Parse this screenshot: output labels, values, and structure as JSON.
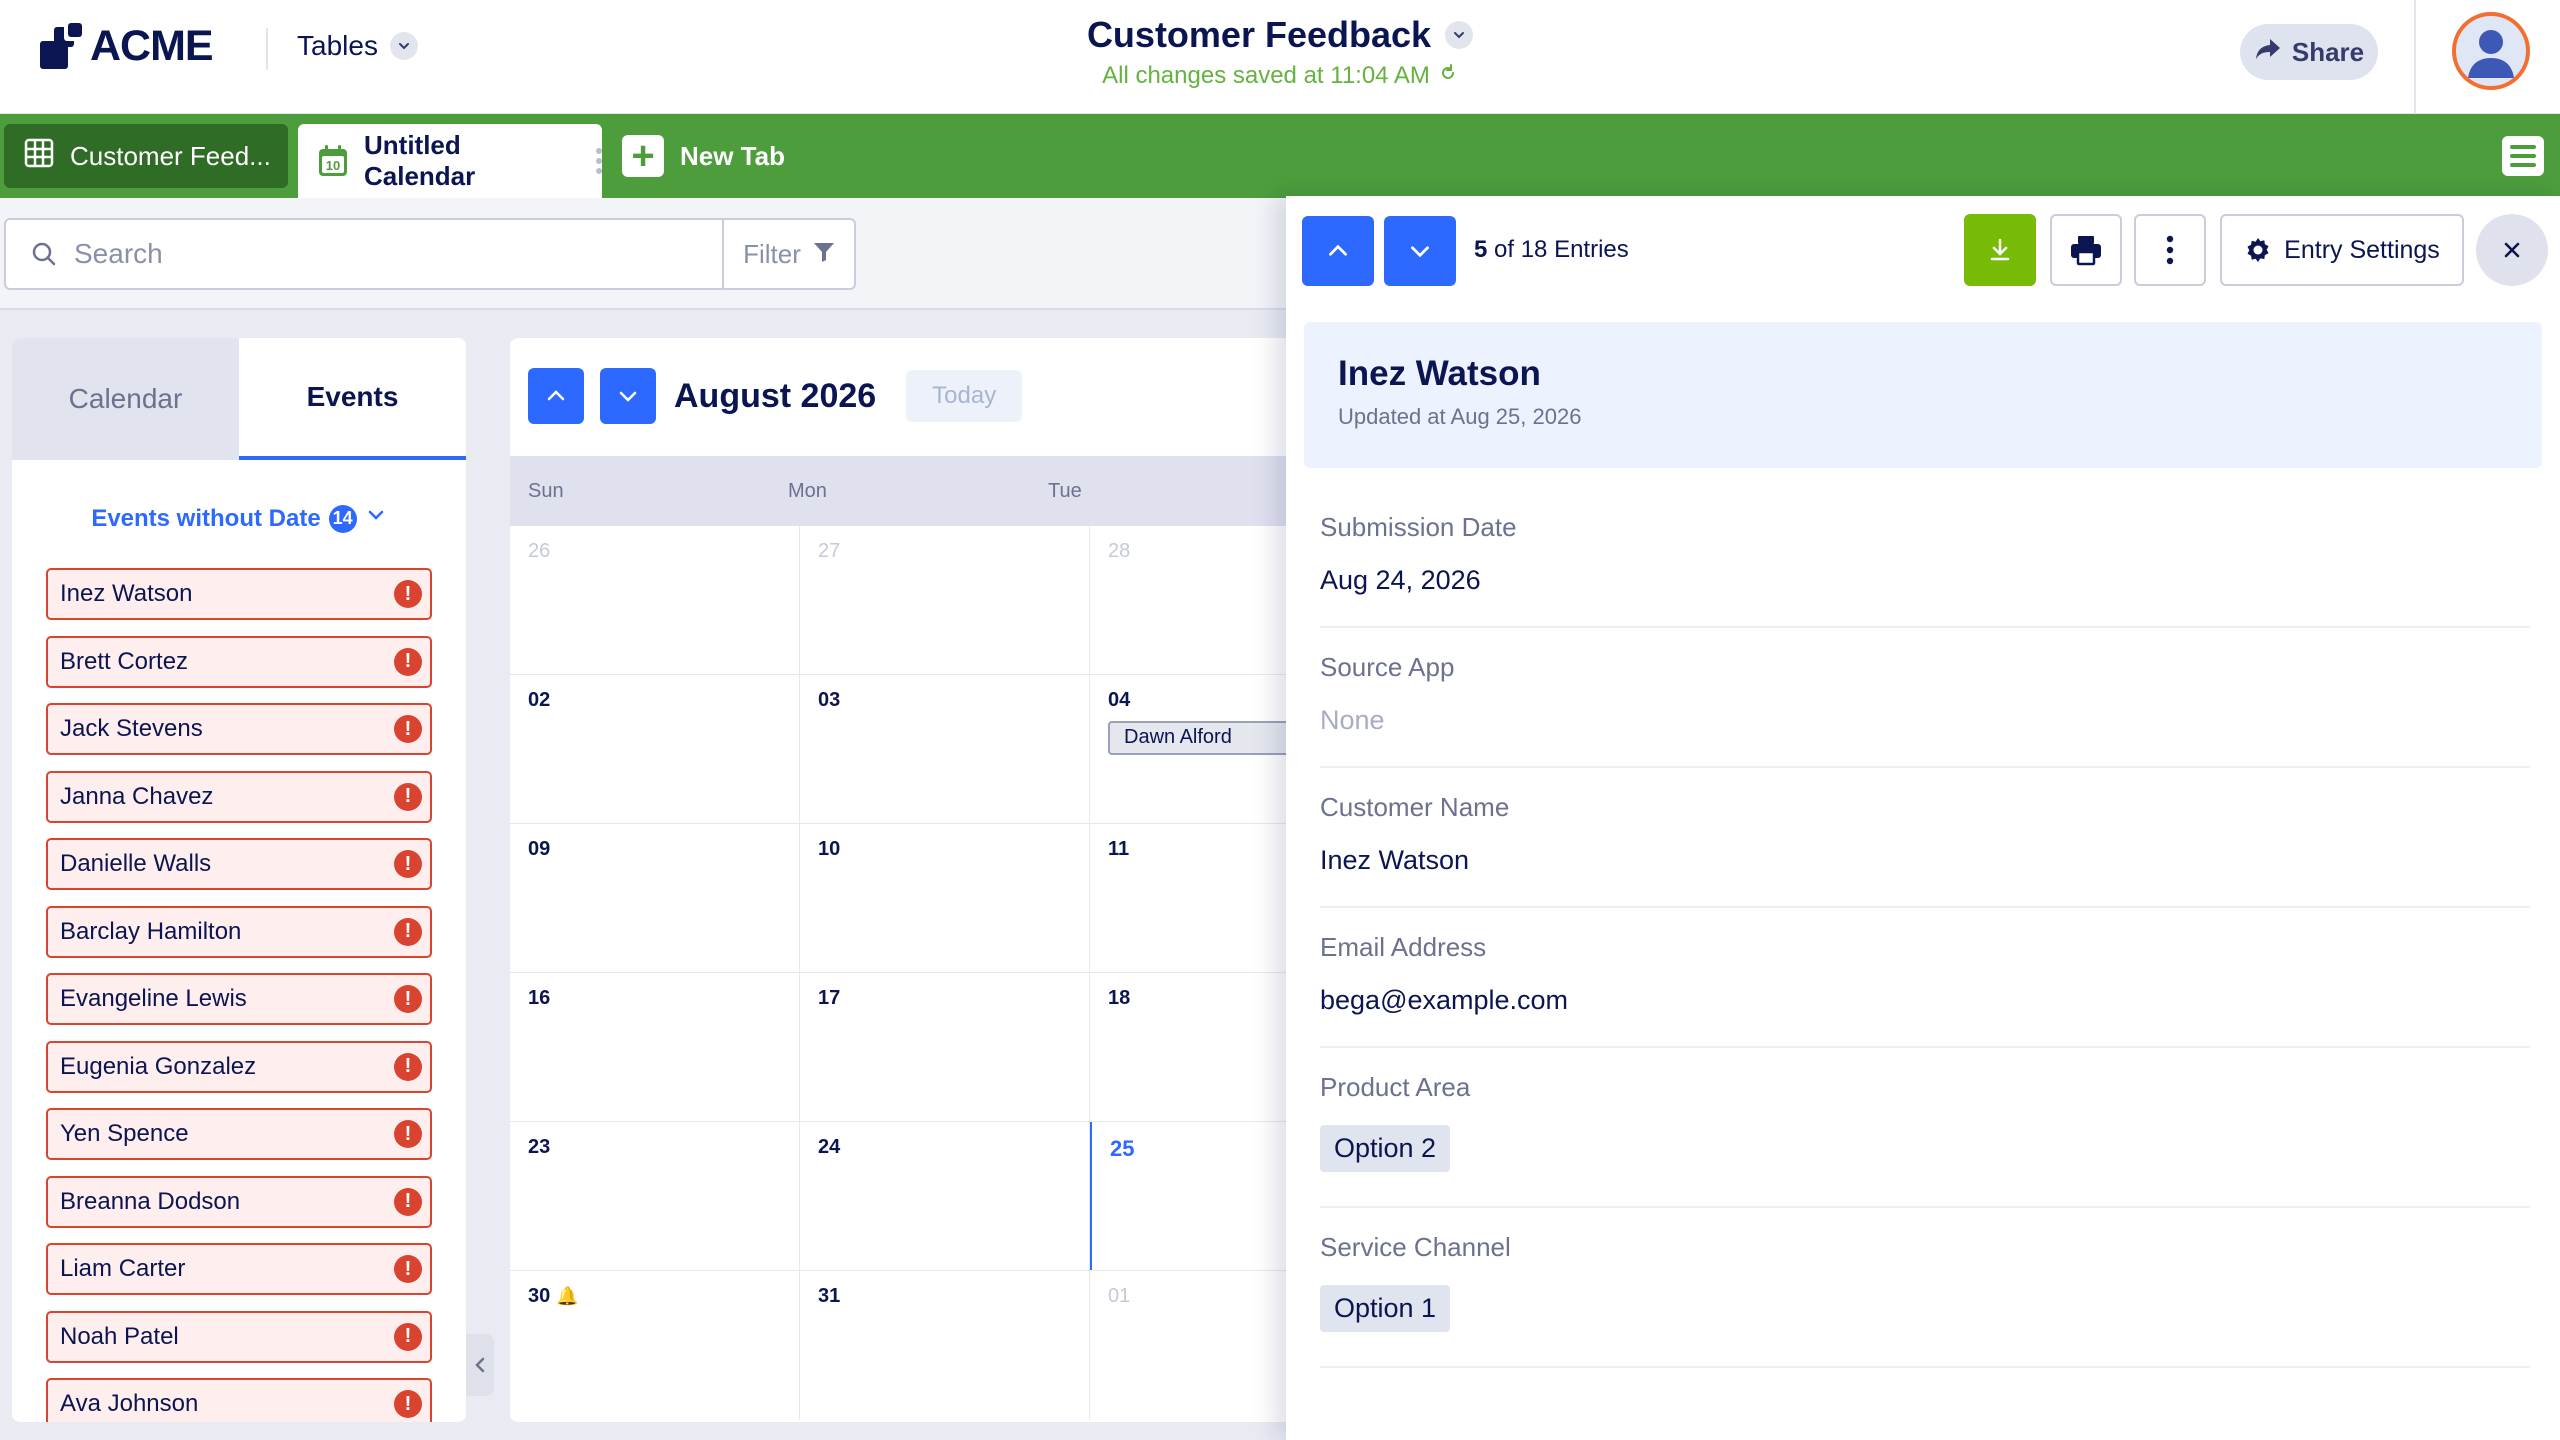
{
  "header": {
    "logo_text": "ACME",
    "tables_label": "Tables",
    "doc_title": "Customer Feedback",
    "save_status": "All changes saved at 11:04 AM",
    "share_label": "Share"
  },
  "tabs": [
    {
      "label": "Customer Feed...",
      "icon": "table-grid-icon"
    },
    {
      "label": "Untitled Calendar",
      "icon": "calendar-icon",
      "calendar_day": "10"
    },
    {
      "label": "New Tab",
      "icon": "plus-icon"
    }
  ],
  "toolbar": {
    "search_placeholder": "Search",
    "filter_label": "Filter"
  },
  "left_panel": {
    "tab_calendar": "Calendar",
    "tab_events": "Events",
    "events_without_date_label": "Events without Date",
    "events_without_date_count": "14",
    "events": [
      "Inez Watson",
      "Brett Cortez",
      "Jack Stevens",
      "Janna Chavez",
      "Danielle Walls",
      "Barclay Hamilton",
      "Evangeline Lewis",
      "Eugenia Gonzalez",
      "Yen Spence",
      "Breanna Dodson",
      "Liam Carter",
      "Noah Patel",
      "Ava Johnson"
    ],
    "warning_glyph": "!"
  },
  "calendar": {
    "month_label": "August 2026",
    "today_label": "Today",
    "weekdays": [
      "Sun",
      "Mon",
      "Tue"
    ],
    "weeks": [
      [
        "26",
        "27",
        "28"
      ],
      [
        "02",
        "03",
        "04"
      ],
      [
        "09",
        "10",
        "11"
      ],
      [
        "16",
        "17",
        "18"
      ],
      [
        "23",
        "24",
        "25"
      ],
      [
        "30",
        "31",
        "01"
      ]
    ],
    "event_dawn": "Dawn Alford"
  },
  "detail": {
    "entries_current": "5",
    "entries_rest": " of 18 Entries",
    "entry_settings_label": "Entry Settings",
    "name": "Inez Watson",
    "updated": "Updated at Aug 25, 2026",
    "fields": {
      "submission_date": {
        "label": "Submission Date",
        "value": "Aug 24, 2026"
      },
      "source_app": {
        "label": "Source App",
        "value": "None"
      },
      "customer_name": {
        "label": "Customer Name",
        "value": "Inez Watson"
      },
      "email": {
        "label": "Email Address",
        "value": "bega@example.com"
      },
      "product_area": {
        "label": "Product Area",
        "value": "Option 2"
      },
      "service_channel": {
        "label": "Service Channel",
        "value": "Option 1"
      }
    }
  },
  "colors": {
    "brand_navy": "#0a1551",
    "tab_bar_green": "#4e9d3c",
    "accent_blue": "#2e69ff",
    "download_green": "#78bb07",
    "warning_red": "#d84430",
    "avatar_ring": "#f36f31"
  }
}
